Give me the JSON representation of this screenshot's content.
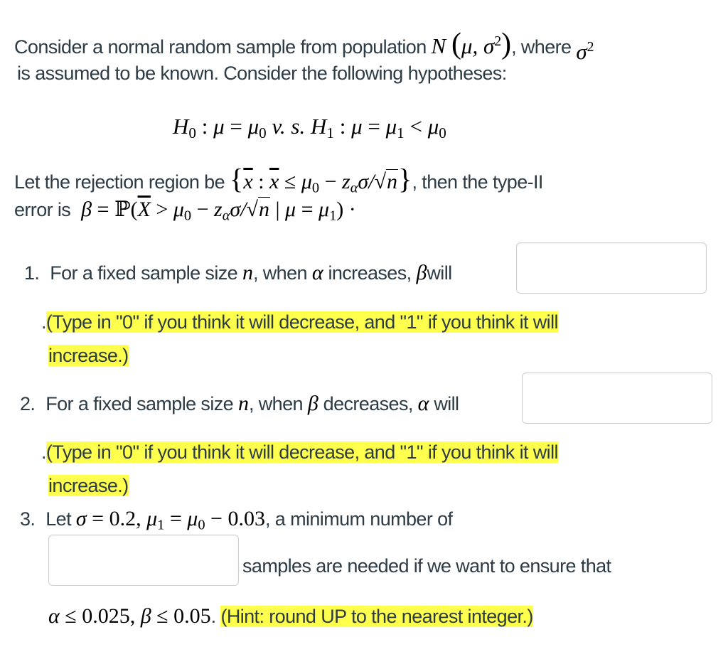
{
  "intro": {
    "line1_text": "Consider a normal random sample from population",
    "line1_math": {
      "N": "N",
      "mu": "μ,",
      "sigma": "σ",
      "exp": "2"
    },
    "line1_where": ", where",
    "line1_sigma2": {
      "sigma": "σ",
      "exp": "2"
    },
    "line2_text": "is assumed to be known. Consider the following hypotheses:"
  },
  "hypotheses": {
    "H0": "H",
    "H0_sub": "0",
    "colon1": " : ",
    "mu1": "μ",
    "eq1": " = ",
    "mu0": "μ",
    "mu0_sub": "0",
    "vs": " v. s. ",
    "H1": "H",
    "H1_sub": "1",
    "colon2": " : ",
    "mu2": "μ",
    "eq2": " = ",
    "mu_1": "μ",
    "mu_1_sub": "1",
    "lt": " < ",
    "mu_0b": "μ",
    "mu_0b_sub": "0"
  },
  "rejection": {
    "prefix": "Let the rejection region be",
    "set_open": "{",
    "xbar1": "x",
    "colon": " : ",
    "xbar2": "x",
    "le": " ≤ ",
    "mu": "μ",
    "mu_sub": "0",
    "minus": " − ",
    "z": "z",
    "z_sub": "α",
    "sigma_over": "σ/",
    "sqrt": "√",
    "n": "n",
    "set_close": "}",
    "suffix": ", then the type-II"
  },
  "beta_def": {
    "prefix": "error is",
    "beta": "β",
    "eq": " = ",
    "P": "ℙ(",
    "Xbar": "X",
    "gt": " > ",
    "mu": "μ",
    "mu_sub": "0",
    "minus": " − ",
    "z": "z",
    "z_sub": "α",
    "sigma_over": "σ/",
    "sqrt": "√",
    "n": "n",
    "given": " | ",
    "mu2": "μ",
    "eq2": " = ",
    "mu1": "μ",
    "mu1_sub": "1",
    "close": ")",
    "dot": " ·"
  },
  "questions": [
    {
      "number": "1.",
      "text_a": "For a fixed sample size",
      "var_n": "n",
      "text_b": ", when",
      "var_1": "α",
      "text_c": "increases,",
      "var_2": "β",
      "text_d": "will",
      "answer_value": "",
      "hint_dot": ".",
      "hint_line1": "(Type in \"0\" if you think it will decrease, and \"1\" if you think it will",
      "hint_line2": "increase.)"
    },
    {
      "number": "2.",
      "text_a": "For a fixed sample size",
      "var_n": "n",
      "text_b": ", when",
      "var_1": "β",
      "text_c": "decreases,",
      "var_2": "α",
      "text_d": "will",
      "answer_value": "",
      "hint_dot": ".",
      "hint_line1": "(Type in \"0\" if you think it will decrease, and \"1\" if you think it will",
      "hint_line2": "increase.)"
    },
    {
      "number": "3.",
      "text_a": "Let",
      "sigma": "σ",
      "eq": " = ",
      "sigma_val": "0.2,",
      "mu1": "μ",
      "mu1_sub": "1",
      "eq2": " = ",
      "mu0": "μ",
      "mu0_sub": "0",
      "minus": " − ",
      "diff": "0.03",
      "text_b": ", a minimum number of",
      "answer_value": "",
      "text_c": "samples are needed if we want to ensure that",
      "alpha": "α",
      "le1": " ≤ ",
      "alpha_val": "0.025,",
      "beta": "β",
      "le2": " ≤ ",
      "beta_val": "0.05",
      "dot": ".",
      "hint": "(Hint: round UP to the nearest integer.)"
    }
  ],
  "colors": {
    "text": "#2d3b45",
    "highlight": "#ffff4d",
    "input_border": "#cfcfcf"
  }
}
